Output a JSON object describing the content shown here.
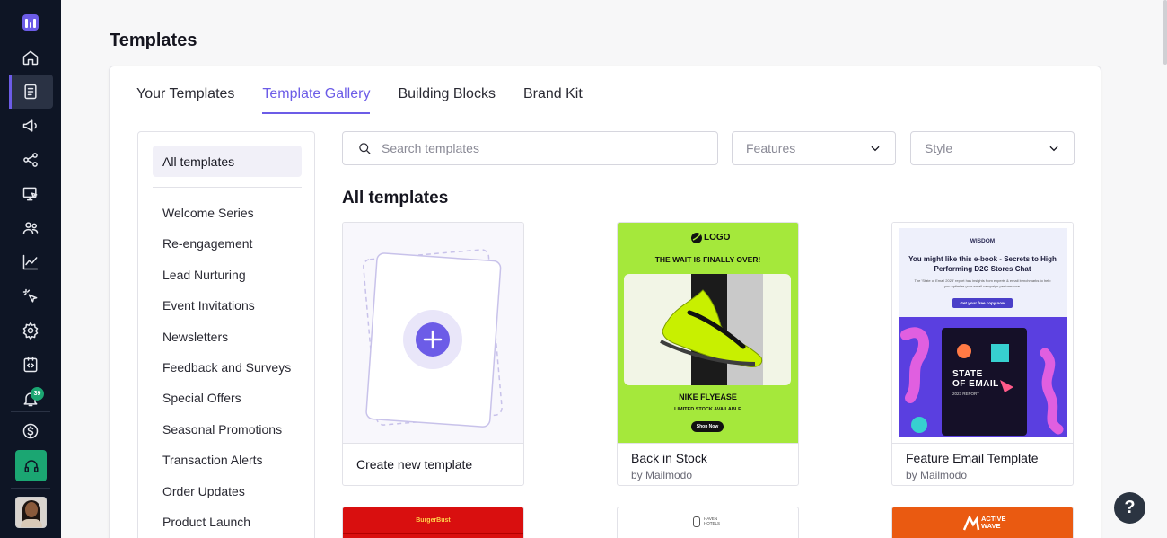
{
  "sidebar": {
    "notification_count": "39",
    "items": [
      {
        "name": "home-icon"
      },
      {
        "name": "templates-icon"
      },
      {
        "name": "campaigns-icon"
      },
      {
        "name": "journeys-icon"
      },
      {
        "name": "landing-pages-icon"
      },
      {
        "name": "audience-icon"
      },
      {
        "name": "analytics-icon"
      },
      {
        "name": "integrations-icon"
      },
      {
        "name": "settings-icon"
      },
      {
        "name": "developer-icon"
      },
      {
        "name": "notifications-icon"
      },
      {
        "name": "billing-icon"
      },
      {
        "name": "support-icon"
      }
    ]
  },
  "page": {
    "title": "Templates"
  },
  "tabs": [
    {
      "label": "Your Templates",
      "active": false
    },
    {
      "label": "Template Gallery",
      "active": true
    },
    {
      "label": "Building Blocks",
      "active": false
    },
    {
      "label": "Brand Kit",
      "active": false
    }
  ],
  "filters": {
    "all_label": "All templates",
    "items": [
      "Welcome Series",
      "Re-engagement",
      "Lead Nurturing",
      "Event Invitations",
      "Newsletters",
      "Feedback and Surveys",
      "Special Offers",
      "Seasonal Promotions",
      "Transaction Alerts",
      "Order Updates",
      "Product Launch"
    ]
  },
  "search": {
    "placeholder": "Search templates"
  },
  "features_select": {
    "value": "Features"
  },
  "style_select": {
    "value": "Style"
  },
  "section_title": "All templates",
  "templates": [
    {
      "name": "Create new template"
    },
    {
      "name": "Back in Stock",
      "by": "by Mailmodo",
      "preview": {
        "logo": "LOGO",
        "headline": "THE WAIT IS FINALLY OVER!",
        "product": "NIKE FLYEASE",
        "subline": "LIMITED STOCK AVAILABLE",
        "cta": "Shop Now"
      }
    },
    {
      "name": "Feature Email Template",
      "by": "by Mailmodo",
      "preview": {
        "logo": "WISDOM",
        "headline": "You might like this e-book - Secrets to High Performing D2C Stores Chat",
        "body": "The 'State of Email 2023' report has insights from experts & email benchmarks to help you optimize your email campaign performance.",
        "cta": "Get your free copy now",
        "cover_title_1": "STATE",
        "cover_title_2": "OF EMAIL",
        "cover_sub": "2023 REPORT"
      }
    }
  ],
  "bottom_templates": [
    {
      "logo": "BurgerBust"
    },
    {
      "logo_1": "HAVEN",
      "logo_2": "HOTELS"
    },
    {
      "logo_1": "ACTIVE",
      "logo_2": "WAVE"
    }
  ],
  "help_label": "?",
  "colors": {
    "accent": "#6c5ce7",
    "sidebar_bg": "#0e1525",
    "support_green": "#1ba672",
    "shoe_bg": "#a5e83b"
  }
}
